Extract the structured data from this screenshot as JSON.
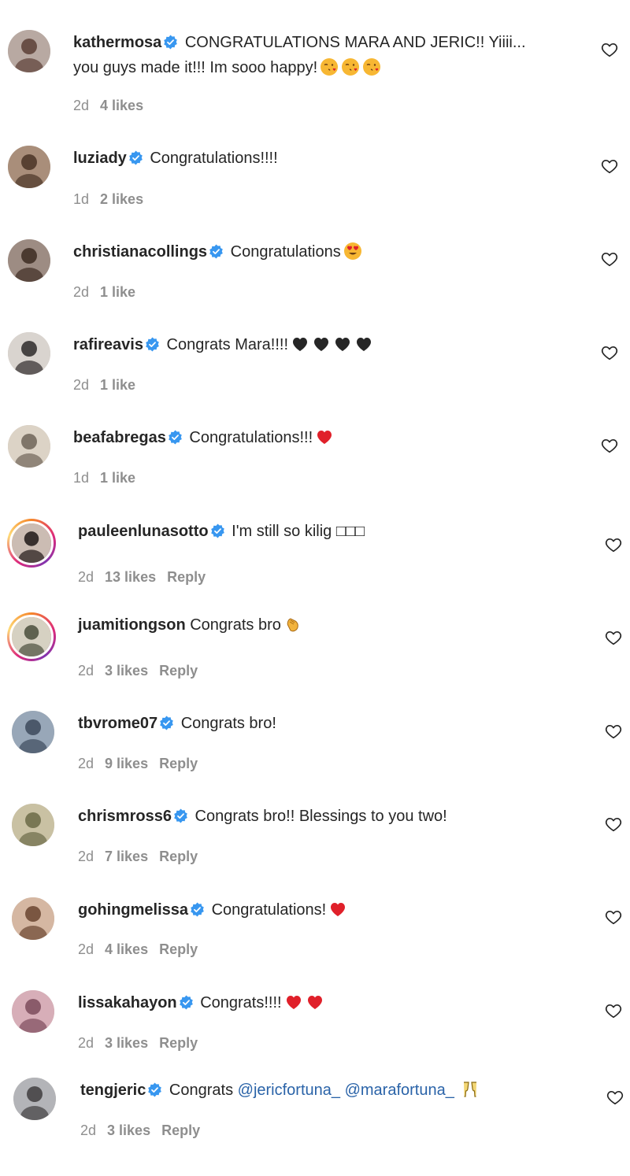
{
  "comments": [
    {
      "username": "kathermosa",
      "verified": true,
      "text": "CONGRATULATIONS MARA AND JERIC!! Yiiii...",
      "text2": "you guys made it!!! Im sooo happy!",
      "emoji": [
        "kiss-face-icon",
        "kiss-face-icon",
        "kiss-face-icon"
      ],
      "time": "2d",
      "likes": "4 likes",
      "reply": ""
    },
    {
      "username": "luziady",
      "verified": true,
      "text": "Congratulations!!!!",
      "emoji": [],
      "time": "1d",
      "likes": "2 likes",
      "reply": ""
    },
    {
      "username": "christianacollings",
      "verified": true,
      "text": "Congratulations",
      "emoji": [
        "heart-eyes-face-icon"
      ],
      "time": "2d",
      "likes": "1 like",
      "reply": ""
    },
    {
      "username": "rafireavis",
      "verified": true,
      "text": "Congrats Mara!!!!",
      "emoji": [
        "black-heart-icon",
        "black-heart-icon",
        "black-heart-icon",
        "black-heart-icon"
      ],
      "time": "2d",
      "likes": "1 like",
      "reply": ""
    },
    {
      "username": "beafabregas",
      "verified": true,
      "text": "Congratulations!!!",
      "emoji": [
        "red-heart-icon"
      ],
      "time": "1d",
      "likes": "1 like",
      "reply": ""
    },
    {
      "username": "pauleenlunasotto",
      "verified": true,
      "text": "I'm still so kilig □□□",
      "emoji": [],
      "time": "2d",
      "likes": "13 likes",
      "reply": "Reply"
    },
    {
      "username": "juamitiongson",
      "verified": false,
      "text": "Congrats bro",
      "emoji": [
        "clapping-hands-icon"
      ],
      "time": "2d",
      "likes": "3 likes",
      "reply": "Reply"
    },
    {
      "username": "tbvrome07",
      "verified": true,
      "text": "Congrats bro!",
      "emoji": [],
      "time": "2d",
      "likes": "9 likes",
      "reply": "Reply"
    },
    {
      "username": "chrismross6",
      "verified": true,
      "text": "Congrats bro!! Blessings to you two!",
      "emoji": [],
      "time": "2d",
      "likes": "7 likes",
      "reply": "Reply"
    },
    {
      "username": "gohingmelissa",
      "verified": true,
      "text": "Congratulations!",
      "emoji": [
        "red-heart-icon"
      ],
      "time": "2d",
      "likes": "4 likes",
      "reply": "Reply"
    },
    {
      "username": "lissakahayon",
      "verified": true,
      "text": "Congrats!!!!",
      "emoji": [
        "red-heart-icon",
        "red-heart-icon"
      ],
      "time": "2d",
      "likes": "3 likes",
      "reply": "Reply"
    },
    {
      "username": "tengjeric",
      "verified": true,
      "text": "Congrats",
      "mentions": [
        "@jericfortuna_",
        "@marafortuna_"
      ],
      "emoji": [
        "clinking-glasses-icon"
      ],
      "time": "2d",
      "likes": "3 likes",
      "reply": "Reply"
    }
  ],
  "colors": {
    "verified": "#3897f0",
    "meta": "#8e8e8e",
    "mention": "#2a63a8",
    "red_heart": "#e0202a",
    "black_heart": "#262626"
  }
}
